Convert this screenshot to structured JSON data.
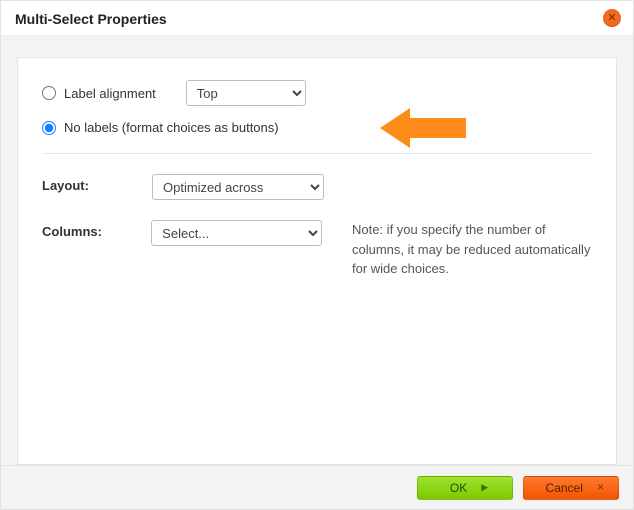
{
  "dialog": {
    "title": "Multi-Select Properties"
  },
  "radios": {
    "label_alignment": "Label alignment",
    "no_labels": "No labels (format choices as buttons)",
    "selected": "no_labels"
  },
  "alignment_select": {
    "value": "Top"
  },
  "layout": {
    "label": "Layout:",
    "value": "Optimized across"
  },
  "columns": {
    "label": "Columns:",
    "placeholder": "Select...",
    "note": "Note: if you specify the number of columns, it may be reduced automatically for wide choices."
  },
  "buttons": {
    "ok": "OK",
    "cancel": "Cancel"
  },
  "colors": {
    "accent_orange": "#f26a1b",
    "ok_green": "#8ed400",
    "cancel_orange": "#f25c12",
    "callout_orange": "#ff8c1a"
  }
}
